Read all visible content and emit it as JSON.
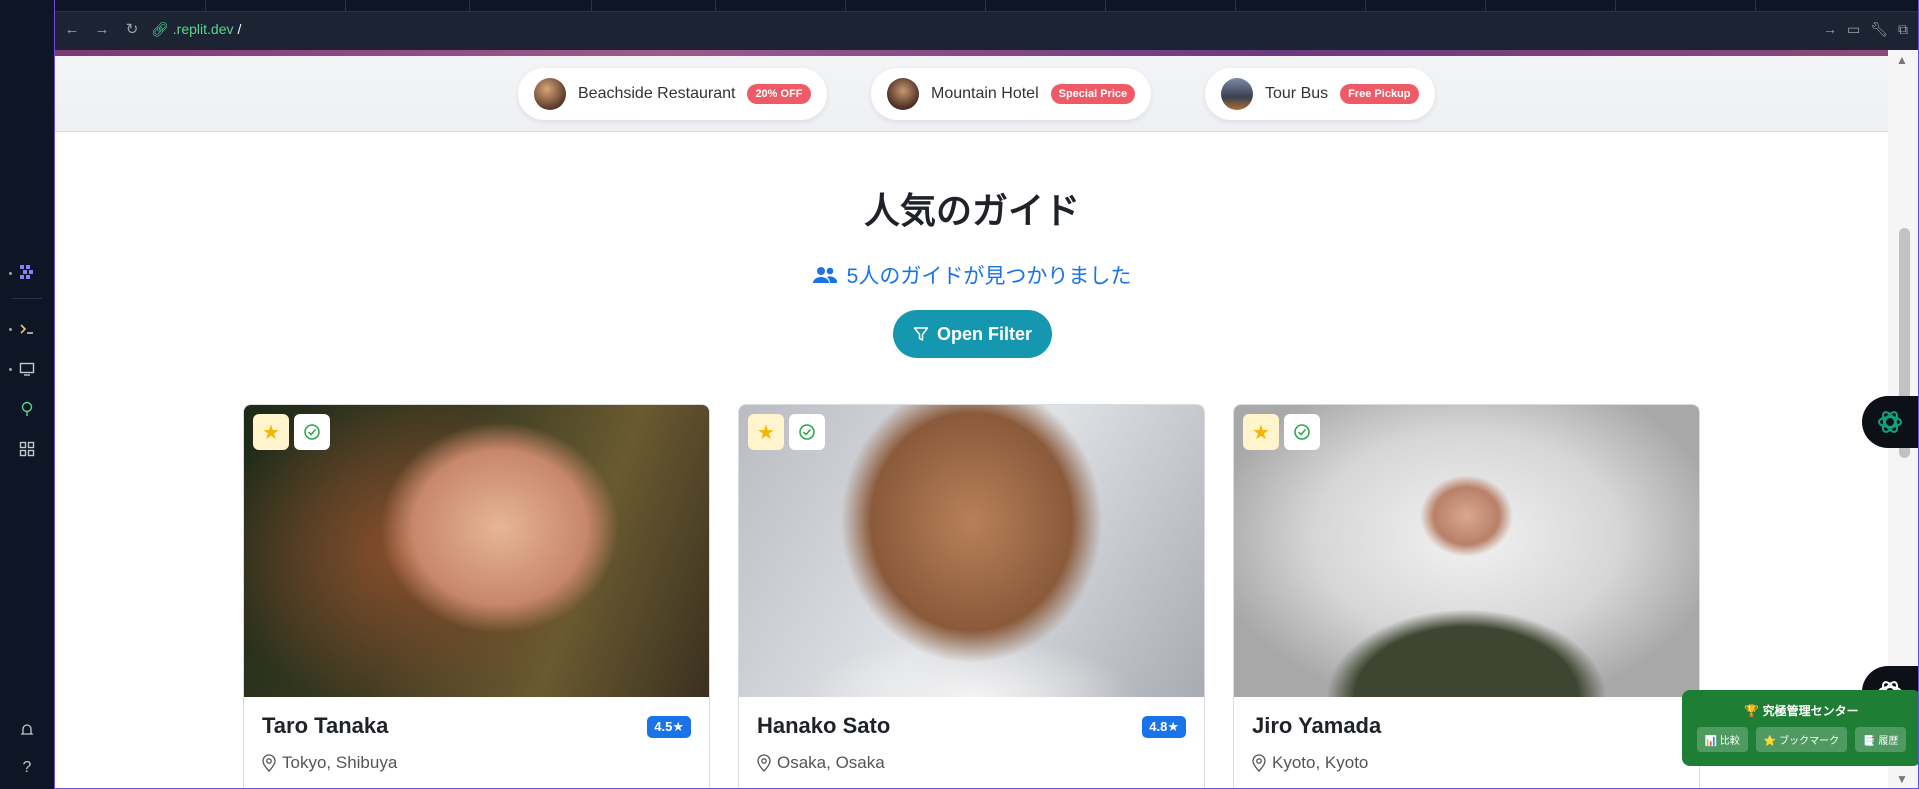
{
  "browser": {
    "url_host": ".replit.dev",
    "url_path": "/"
  },
  "partners": [
    {
      "name": "Beachside Restaurant",
      "badge": "20% OFF"
    },
    {
      "name": "Mountain Hotel",
      "badge": "Special Price"
    },
    {
      "name": "Tour Bus",
      "badge": "Free Pickup"
    }
  ],
  "section": {
    "title": "人気のガイド",
    "found_text": "5人のガイドが見つかりました",
    "filter_label": "Open Filter"
  },
  "guides": [
    {
      "name": "Taro Tanaka",
      "rating": "4.5★",
      "location": "Tokyo, Shibuya"
    },
    {
      "name": "Hanako Sato",
      "rating": "4.8★",
      "location": "Osaka, Osaka"
    },
    {
      "name": "Jiro Yamada",
      "rating": "",
      "location": "Kyoto, Kyoto"
    }
  ],
  "admin_panel": {
    "title": "🏆 究極管理センター",
    "buttons": [
      "📊 比較",
      "⭐ ブックマーク",
      "📑 履歴"
    ]
  },
  "colors": {
    "accent_blue": "#1a73e8",
    "filter_teal": "#1597b0",
    "badge_red": "#ef5a67",
    "admin_green": "#1e7e34"
  }
}
